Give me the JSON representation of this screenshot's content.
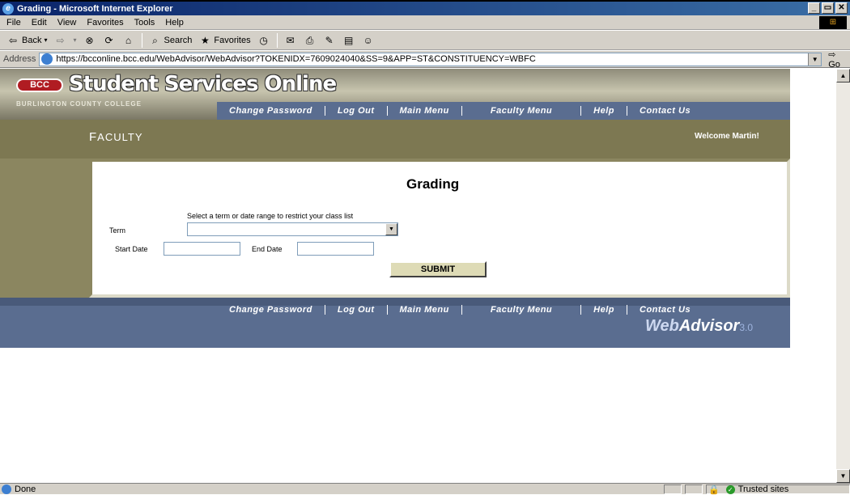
{
  "window": {
    "title": "Grading - Microsoft Internet Explorer",
    "controls": [
      "_",
      "▭",
      "✕"
    ]
  },
  "menu": [
    "File",
    "Edit",
    "View",
    "Favorites",
    "Tools",
    "Help"
  ],
  "toolbar": {
    "back": "Back",
    "search": "Search",
    "favorites": "Favorites"
  },
  "address": {
    "label": "Address",
    "url": "https://bcconline.bcc.edu/WebAdvisor/WebAdvisor?TOKENIDX=7609024040&SS=9&APP=ST&CONSTITUENCY=WBFC",
    "go": "Go"
  },
  "header": {
    "badge": "BCC",
    "logo": "Student Services Online",
    "college": "BURLINGTON COUNTY COLLEGE"
  },
  "nav": [
    "Change Password",
    "Log Out",
    "Main Menu",
    "Faculty Menu",
    "Help",
    "Contact Us"
  ],
  "section": {
    "title_first": "F",
    "title_rest": "ACULTY",
    "welcome": "Welcome Martin!"
  },
  "form": {
    "title": "Grading",
    "instruction": "Select a term or date range to restrict your class list",
    "term_label": "Term",
    "term_value": "",
    "start_label": "Start Date",
    "start_value": "",
    "end_label": "End Date",
    "end_value": "",
    "submit": "SUBMIT"
  },
  "footer": {
    "brand_web": "Web",
    "brand_advisor": "Advisor",
    "version": "3.0"
  },
  "status": {
    "text": "Done",
    "zone": "Trusted sites"
  }
}
